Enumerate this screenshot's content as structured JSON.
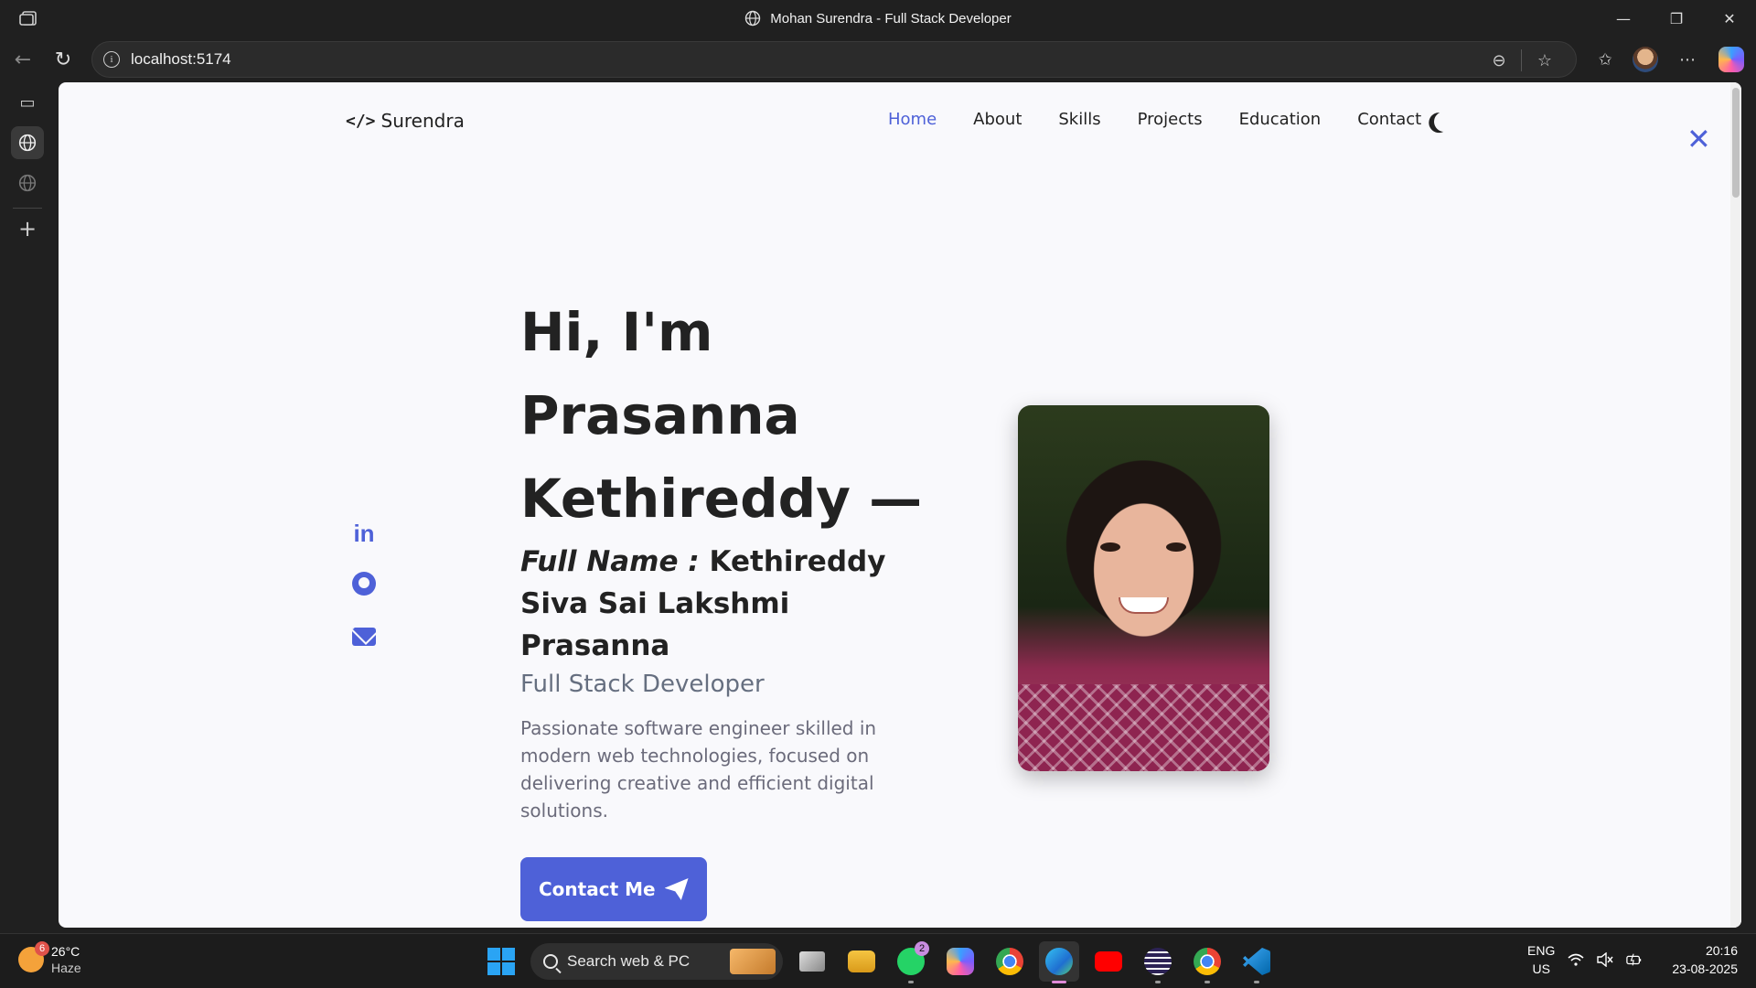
{
  "window": {
    "title": "Mohan Surendra - Full Stack Developer",
    "minimize": "—",
    "restore": "❐",
    "close": "✕"
  },
  "address_bar": {
    "url": "localhost:5174"
  },
  "site": {
    "logo_glyph": "</>",
    "logo_text": "Surendra",
    "nav": [
      {
        "label": "Home",
        "active": true
      },
      {
        "label": "About"
      },
      {
        "label": "Skills"
      },
      {
        "label": "Projects"
      },
      {
        "label": "Education"
      },
      {
        "label": "Contact"
      }
    ],
    "close_menu": "✕",
    "social": {
      "linkedin": "in"
    },
    "hero": {
      "line1": "Hi, I'm",
      "line2": "Prasanna",
      "line3": "Kethireddy —",
      "full_name_label": "Full Name :",
      "full_name_value": " Kethireddy Siva Sai Lakshmi Prasanna",
      "role": "Full Stack Developer",
      "description": "Passionate software engineer skilled in modern web technologies, focused on delivering creative and efficient digital solutions.",
      "cta": "Contact Me"
    },
    "accent_color": "#4e61d8"
  },
  "taskbar": {
    "weather": {
      "temp": "26°C",
      "condition": "Haze",
      "badge": "6"
    },
    "search_placeholder": "Search web & PC",
    "whatsapp_badge": "2",
    "lang_top": "ENG",
    "lang_bottom": "US",
    "time": "20:16",
    "date": "23-08-2025"
  }
}
